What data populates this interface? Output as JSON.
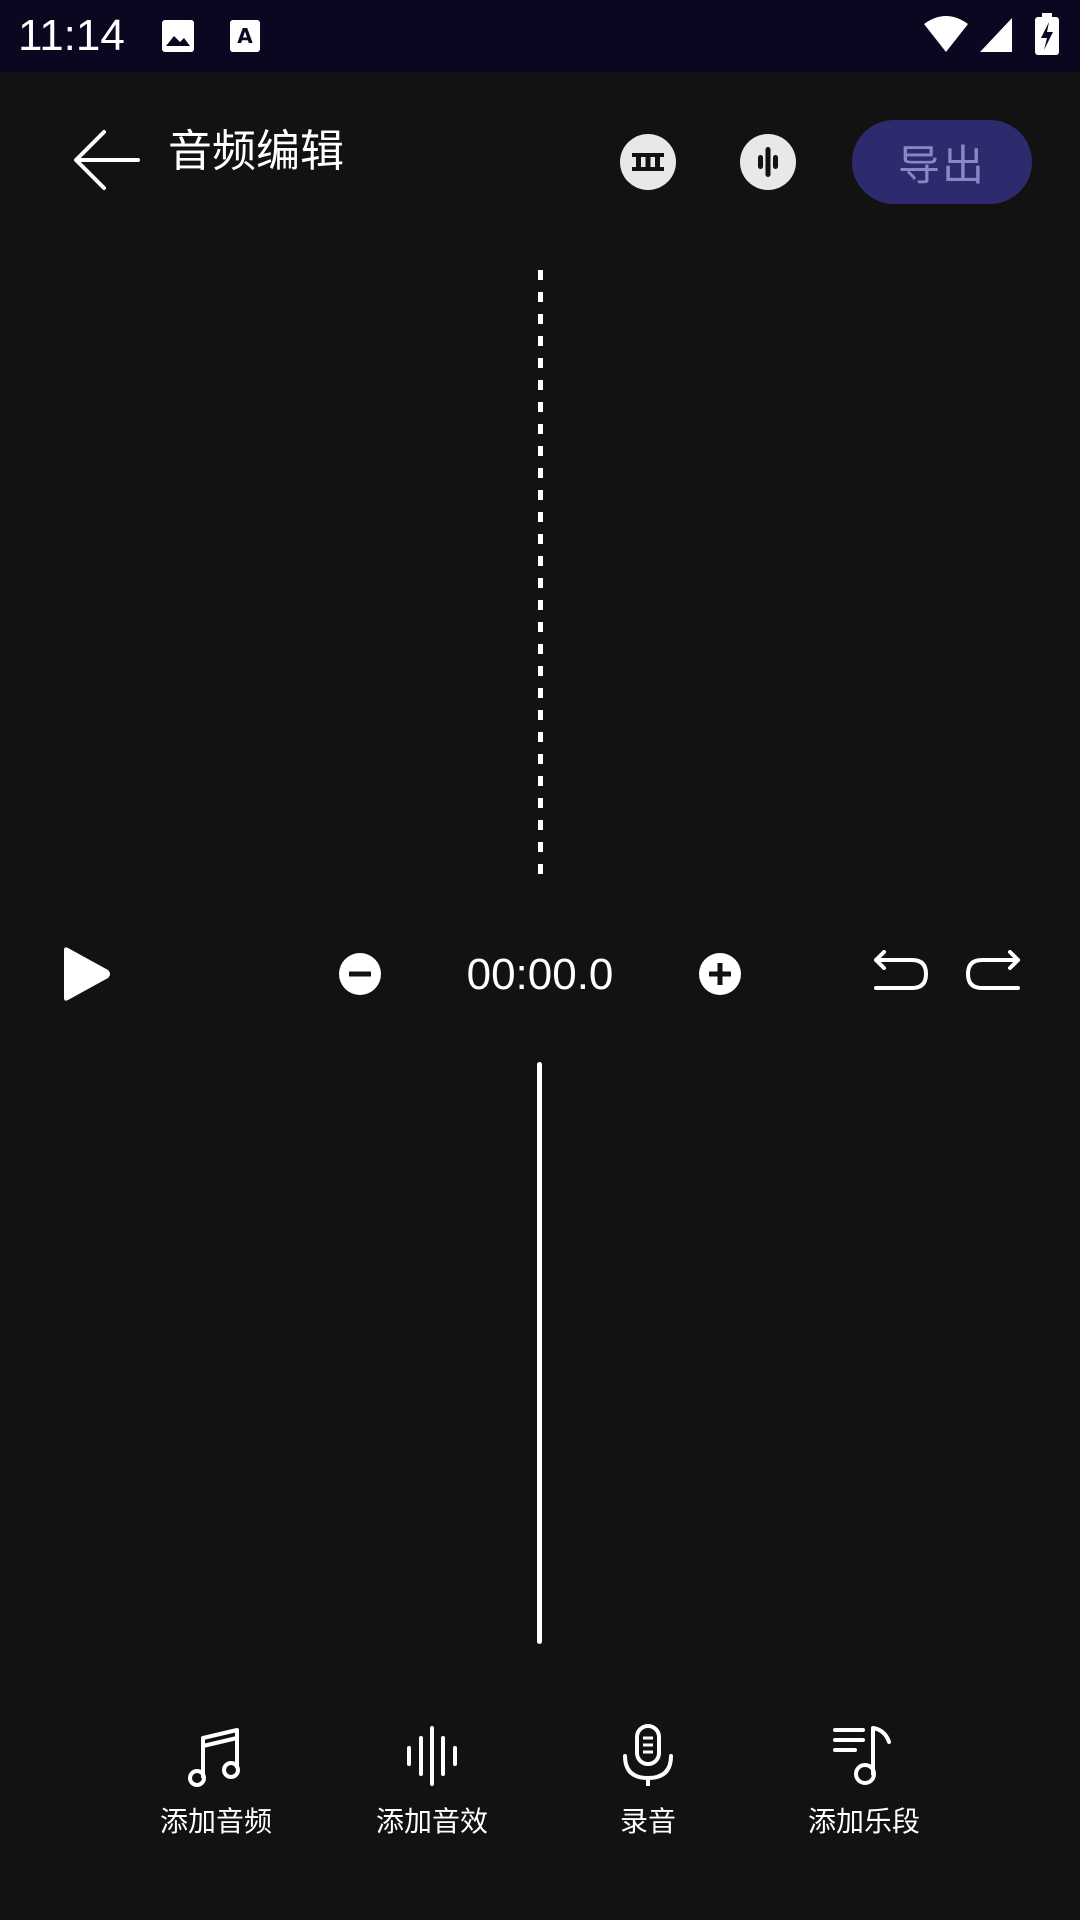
{
  "status_bar": {
    "time": "11:14",
    "icons": [
      "image-icon",
      "text-a-icon",
      "wifi-icon",
      "signal-icon",
      "battery-charging-icon"
    ]
  },
  "app_bar": {
    "title": "音频编辑",
    "back_icon": "arrow-left-icon",
    "action_icons": [
      "film-strip-icon",
      "waveform-icon"
    ],
    "export_label": "导出"
  },
  "controls": {
    "time": "00:00.0",
    "icons": [
      "play-icon",
      "zoom-out-icon",
      "zoom-in-icon",
      "undo-icon",
      "redo-icon"
    ]
  },
  "tools": {
    "items": [
      {
        "label": "添加音频",
        "icon": "music-note-icon"
      },
      {
        "label": "添加音效",
        "icon": "sound-wave-icon"
      },
      {
        "label": "录音",
        "icon": "microphone-icon"
      },
      {
        "label": "添加乐段",
        "icon": "playlist-music-icon"
      }
    ]
  },
  "colors": {
    "background": "#121212",
    "status_bar": "#0c0620",
    "export_button_bg": "#2d2a6e",
    "export_button_text": "#8a86c8"
  }
}
